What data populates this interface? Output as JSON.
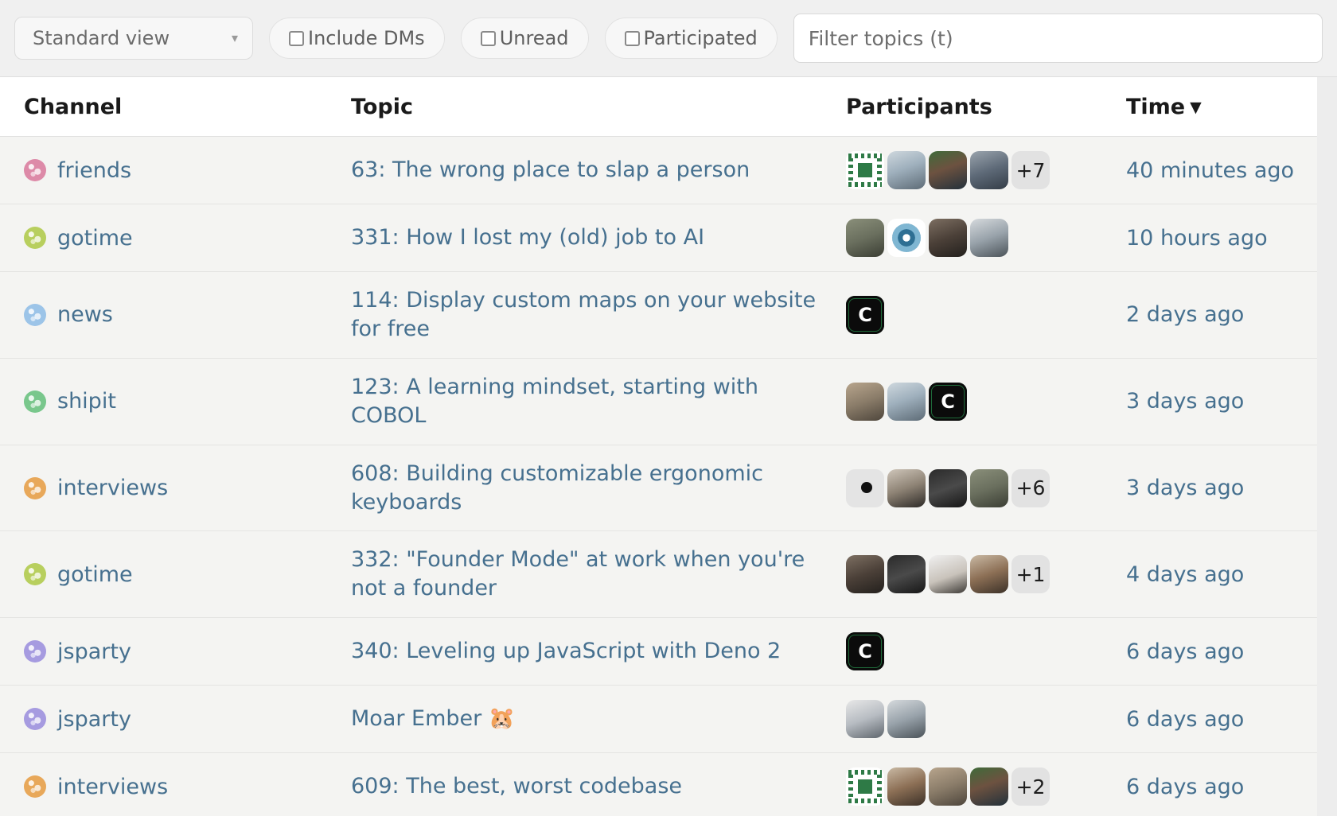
{
  "toolbar": {
    "view_select": {
      "label": "Standard view",
      "chevron": "chevron-down-icon"
    },
    "checkboxes": [
      {
        "label": "Include DMs",
        "checked": false
      },
      {
        "label": "Unread",
        "checked": false
      },
      {
        "label": "Participated",
        "checked": false
      }
    ],
    "filter": {
      "value": "",
      "placeholder": "Filter topics (t)"
    }
  },
  "table": {
    "columns": [
      {
        "label": "Channel",
        "sorted": false
      },
      {
        "label": "Topic",
        "sorted": false
      },
      {
        "label": "Participants",
        "sorted": false
      },
      {
        "label": "Time",
        "sorted": true,
        "sort_arrow": "▼"
      }
    ],
    "rows": [
      {
        "channel": "friends",
        "channel_color": "#dd8aa8",
        "topic": "63: The wrong place to slap a person",
        "avatars": [
          "a-green-tile",
          "ph-man-1",
          "ph-man-2",
          "ph-man-3"
        ],
        "overflow": "+7",
        "time": "40 minutes ago"
      },
      {
        "channel": "gotime",
        "channel_color": "#b8cf5e",
        "topic": "331: How I lost my (old) job to AI",
        "avatars": [
          "ph-man-7",
          "a-wave",
          "ph-man-8",
          "ph-man-6"
        ],
        "overflow": "",
        "time": "10 hours ago"
      },
      {
        "channel": "news",
        "channel_color": "#9cc4e8",
        "topic": "114: Display custom maps on your website for free",
        "avatars": [
          "a-c-logo"
        ],
        "overflow": "",
        "time": "2 days ago"
      },
      {
        "channel": "shipit",
        "channel_color": "#79c78c",
        "topic": "123: A learning mindset, starting with COBOL",
        "avatars": [
          "ph-man-4",
          "ph-man-1",
          "a-c-logo"
        ],
        "overflow": "",
        "time": "3 days ago"
      },
      {
        "channel": "interviews",
        "channel_color": "#e8a85a",
        "topic": "608: Building customizable ergonomic keyboards",
        "avatars": [
          "a-calvin",
          "ph-man-5",
          "ph-man-9",
          "ph-man-7"
        ],
        "overflow": "+6",
        "time": "3 days ago"
      },
      {
        "channel": "gotime",
        "channel_color": "#b8cf5e",
        "topic": "332: \"Founder Mode\" at work when you're not a founder",
        "avatars": [
          "ph-man-8",
          "ph-man-9",
          "ph-man-11",
          "ph-man-12"
        ],
        "overflow": "+1",
        "time": "4 days ago"
      },
      {
        "channel": "jsparty",
        "channel_color": "#a69be0",
        "topic": "340: Leveling up JavaScript with Deno 2",
        "avatars": [
          "a-c-logo"
        ],
        "overflow": "",
        "time": "6 days ago"
      },
      {
        "channel": "jsparty",
        "channel_color": "#a69be0",
        "topic": "Moar Ember 🐹",
        "avatars": [
          "ph-man-10",
          "ph-man-6"
        ],
        "overflow": "",
        "time": "6 days ago"
      },
      {
        "channel": "interviews",
        "channel_color": "#e8a85a",
        "topic": "609: The best, worst codebase",
        "avatars": [
          "a-green-tile",
          "ph-man-12",
          "ph-man-4",
          "ph-man-2"
        ],
        "overflow": "+2",
        "time": "6 days ago"
      }
    ]
  },
  "colors": {
    "link": "#46708f",
    "toolbar_bg": "#f0f0f0",
    "row_bg": "#f4f4f2",
    "header_bg": "#ffffff",
    "badge_bg": "#e2e2e2"
  }
}
